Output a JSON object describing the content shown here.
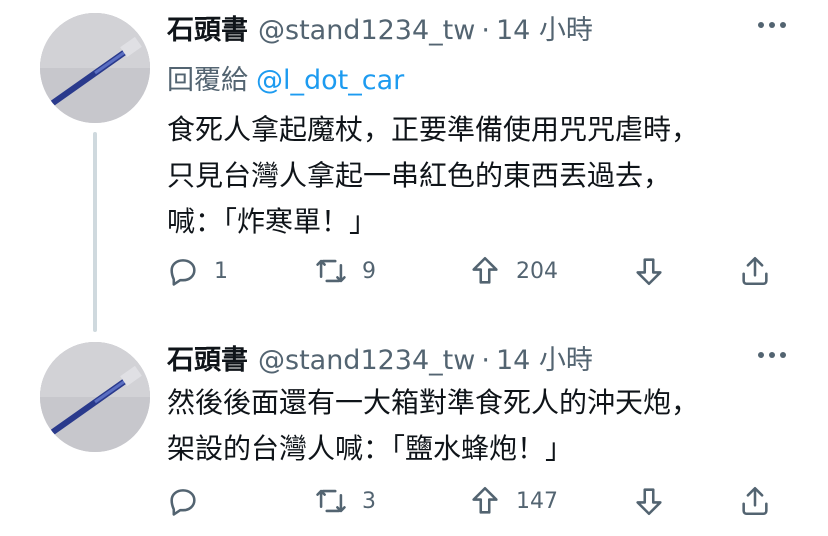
{
  "tweets": [
    {
      "name": "石頭書",
      "handle": "@stand1234_tw",
      "separator": "·",
      "time": "14 小時",
      "reply_prefix": "回覆給",
      "reply_mention": "@l_dot_car",
      "lines": [
        "食死人拿起魔杖，正要準備使用咒咒虐時，",
        "只見台灣人拿起一串紅色的東西丟過去，",
        "喊：「炸寒單！」"
      ],
      "replies": "1",
      "retweets": "9",
      "likes": "204"
    },
    {
      "name": "石頭書",
      "handle": "@stand1234_tw",
      "separator": "·",
      "time": "14 小時",
      "lines": [
        "然後後面還有一大箱對準食死人的沖天炮，",
        "架設的台灣人喊：「鹽水蜂炮！」"
      ],
      "replies": "",
      "retweets": "3",
      "likes": "147"
    }
  ],
  "icons": {
    "more": "more-dots-icon",
    "reply": "reply-bubble-icon",
    "retweet": "retweet-icon",
    "like": "upvote-arrow-icon",
    "downvote": "downvote-arrow-icon",
    "share": "share-icon"
  },
  "colors": {
    "text": "#0f1419",
    "secondary": "#536471",
    "mention": "#1d9bf0",
    "thread_line": "#cfd9de"
  }
}
